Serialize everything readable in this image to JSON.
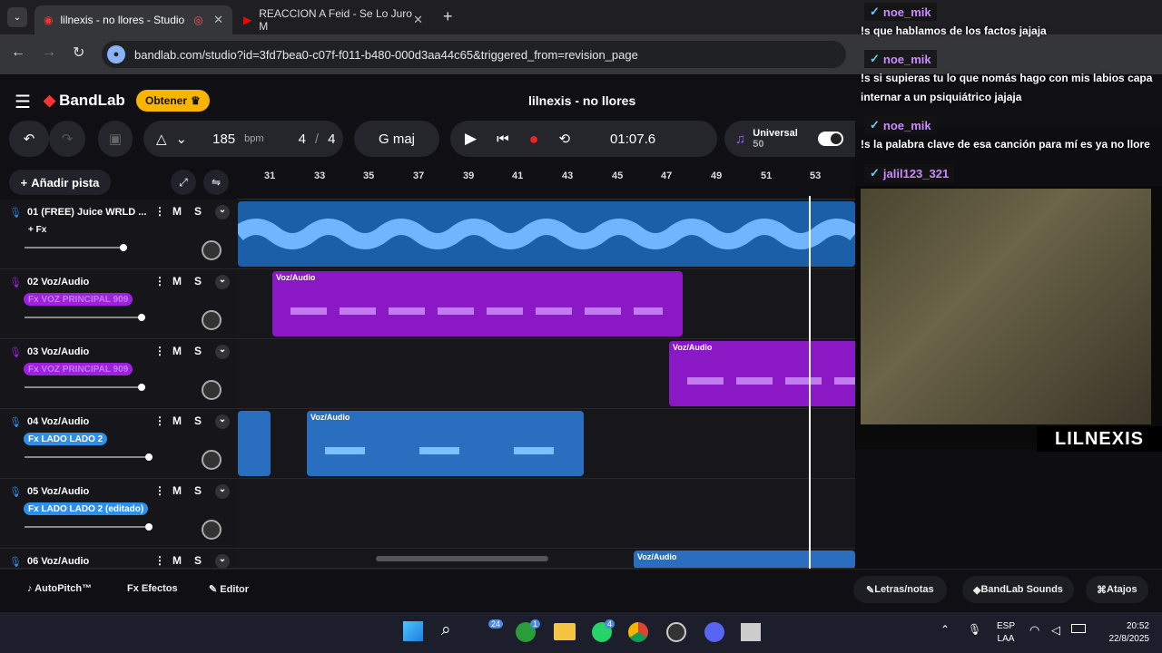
{
  "browser": {
    "tabs": [
      {
        "title": "lilnexis - no llores - Studio"
      },
      {
        "title": "REACCION A Feid - Se Lo Juro M"
      }
    ],
    "url": "bandlab.com/studio?id=3fd7bea0-c07f-f011-b480-000d3aa44c65&triggered_from=revision_page"
  },
  "app": {
    "logo": "BandLab",
    "get_button": "Obtener",
    "project_title": "lilnexis - no llores"
  },
  "toolbar": {
    "bpm": "185",
    "bpm_unit": "bpm",
    "time_sig_num": "4",
    "time_sig_den": "4",
    "key": "G maj",
    "time": "01:07.6",
    "metronome_label": "Universal",
    "metronome_value": "50",
    "add_track": "Añadir pista"
  },
  "ruler": [
    "31",
    "33",
    "35",
    "37",
    "39",
    "41",
    "43",
    "45",
    "47",
    "49",
    "51",
    "53"
  ],
  "tracks": [
    {
      "name": "01  (FREE) Juice WRLD ...",
      "fx": "+ Fx",
      "color": "#2f7fd8",
      "volume": 0.78
    },
    {
      "name": "02  Voz/Audio",
      "fx": "Fx VOZ PRINCIPAL 909",
      "color": "#a020e0",
      "volume": 0.92
    },
    {
      "name": "03  Voz/Audio",
      "fx": "Fx VOZ PRINCIPAL 909",
      "color": "#a020e0",
      "volume": 0.92
    },
    {
      "name": "04  Voz/Audio",
      "fx": "Fx LADO LADO 2",
      "color": "#2f8fe8",
      "volume": 0.98
    },
    {
      "name": "05  Voz/Audio",
      "fx": "Fx LADO LADO 2 (editado)",
      "color": "#2f8fe8",
      "volume": 0.98
    },
    {
      "name": "06  Voz/Audio",
      "fx": "",
      "color": "#2f8fe8",
      "volume": 0.9
    }
  ],
  "clips": {
    "label": "Voz/Audio"
  },
  "bottom": {
    "autopitch": "AutoPitch™",
    "effects": "Efectos",
    "editor": "Editor",
    "lyrics": "Letras/notas",
    "sounds": "BandLab Sounds",
    "shortcuts": "Atajos"
  },
  "chat": [
    {
      "user": "noe_mik",
      "text": "!s que hablamos de los factos jajaja"
    },
    {
      "user": "noe_mik",
      "text": "!s si supieras tu lo que nomás hago con mis labios capa",
      "text2": "internar a un psiquiátrico jajaja"
    },
    {
      "user": "noe_mik",
      "text": "!s la palabra clave de esa canción para mí es ya no llore"
    },
    {
      "user": "jalil123_321",
      "text": ""
    }
  ],
  "cam": {
    "label": "LILNEXIS"
  },
  "taskbar": {
    "lang": "ESP",
    "layout": "LAA",
    "time": "20:52",
    "date": "22/8/2025",
    "badge1": "24",
    "badge2": "1",
    "badge3": "4"
  }
}
